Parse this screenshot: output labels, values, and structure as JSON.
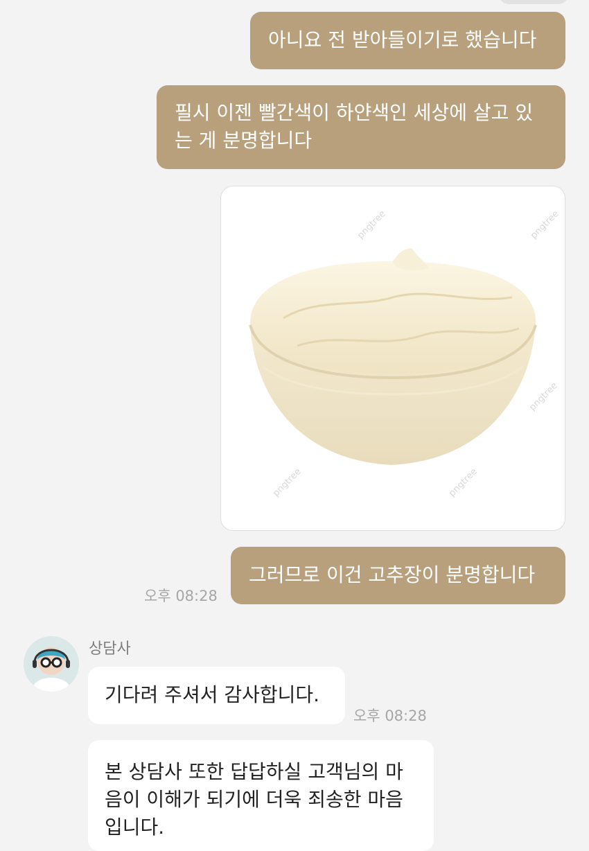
{
  "messages": {
    "out1": {
      "text": "아니요 전 받아들이기로 했습니다"
    },
    "out2": {
      "line1": "필시 이젠 빨간색이 하얀색인 세상에 살고 있",
      "line2": "는 게 분명합니다"
    },
    "image": {
      "icon": "cream-bowl-image",
      "watermark": "pngtree"
    },
    "out3": {
      "text": "그러므로 이건 고추장이 분명합니다",
      "time": "오후 08:28"
    },
    "agent": {
      "name": "상담사",
      "avatar_icon": "agent-avatar-icon"
    },
    "in1": {
      "text": "기다려 주셔서 감사합니다.",
      "time": "오후 08:28"
    },
    "in2": {
      "line1": "본 상담사 또한 답답하실 고객님의 마",
      "line2": "음이 이해가 되기에 더욱 죄송한 마음",
      "line3": "입니다."
    }
  },
  "colors": {
    "outgoing_bubble": "#b9a07c",
    "incoming_bubble": "#ffffff",
    "background": "#f3f3f3"
  }
}
